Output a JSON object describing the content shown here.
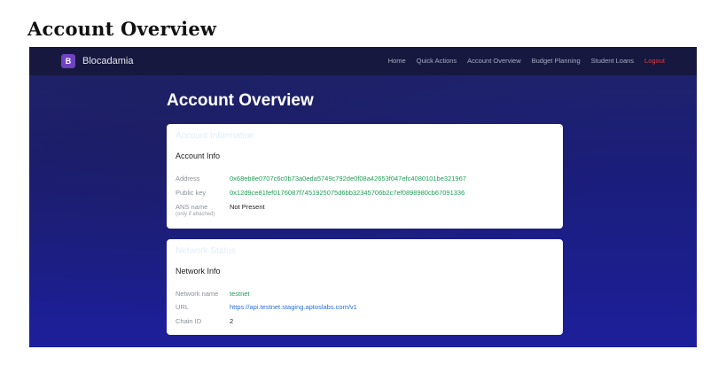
{
  "document": {
    "title": "Account Overview"
  },
  "navbar": {
    "brand_logo": "B",
    "brand_name": "Blocadamia",
    "links": [
      "Home",
      "Quick Actions",
      "Account Overview",
      "Budget Planning",
      "Student Loans",
      "Logout"
    ]
  },
  "page": {
    "title": "Account Overview"
  },
  "account_card": {
    "header": "Account Information",
    "subtitle": "Account Info",
    "rows": [
      {
        "label": "Address",
        "value": "0x68eb8e0707c6c0b73a0eda5749c792de0f08a42653f047efc4080101be321967"
      },
      {
        "label": "Public key",
        "value": "0x12d9ce81fef0176087f7451925075d6bb32345706b2c7ef0898980cb67091336"
      },
      {
        "label": "ANS name",
        "sublabel": "(only if attached)",
        "value": "Not Present"
      }
    ]
  },
  "network_card": {
    "header": "Network Status",
    "subtitle": "Network Info",
    "rows": [
      {
        "label": "Network name",
        "value": "testnet"
      },
      {
        "label": "URL",
        "value": "https://api.testnet.staging.aptoslabs.com/v1"
      },
      {
        "label": "Chain ID",
        "value": "2"
      }
    ]
  },
  "colors": {
    "brand_accent": "#6f42c1",
    "logout": "#e03c3c",
    "value_green": "#1f9d55",
    "link_blue": "#2b6fd6",
    "navbar_bg": "#16183f",
    "page_bg": "#1c1f9a"
  }
}
